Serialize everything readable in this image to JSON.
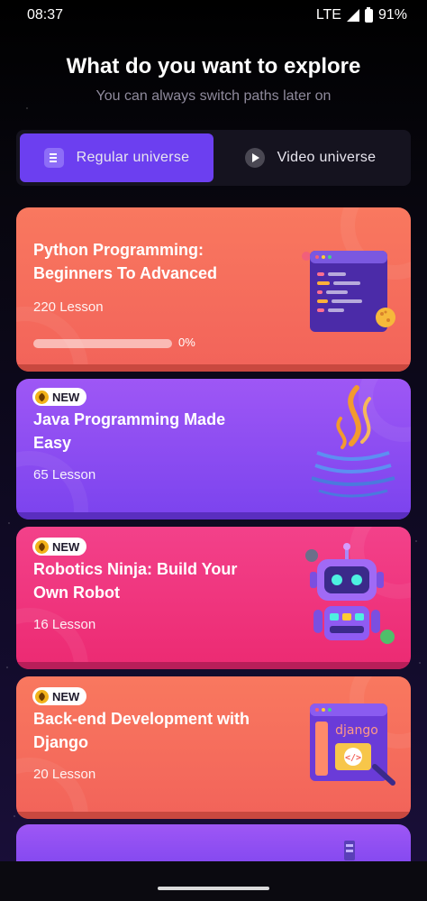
{
  "status_bar": {
    "time": "08:37",
    "network": "LTE",
    "battery": "91%"
  },
  "header": {
    "title": "What do you want to explore",
    "subtitle": "You can always switch paths later on"
  },
  "toggle": {
    "regular_label": "Regular universe",
    "video_label": "Video universe",
    "selected": "Regular universe"
  },
  "courses": [
    {
      "title": "Python Programming: Beginners To Advanced",
      "lessons": "220 Lesson",
      "progress_text": "0%",
      "progress": 0,
      "is_new": false,
      "icon": "code-window-icon"
    },
    {
      "title": "Java Programming Made Easy",
      "lessons": "65 Lesson",
      "is_new": true,
      "badge": "NEW",
      "icon": "java-coffee-icon"
    },
    {
      "title": "Robotics Ninja: Build Your Own Robot",
      "lessons": "16 Lesson",
      "is_new": true,
      "badge": "NEW",
      "icon": "robot-icon"
    },
    {
      "title": "Back-end Development with Django",
      "lessons": "20 Lesson",
      "is_new": true,
      "badge": "NEW",
      "icon": "django-window-icon",
      "icon_text": "django"
    }
  ],
  "colors": {
    "accent": "#6c3ff0",
    "card_orange": "#f46a5e",
    "card_purple": "#8a4cf2",
    "card_pink": "#f0347e"
  }
}
